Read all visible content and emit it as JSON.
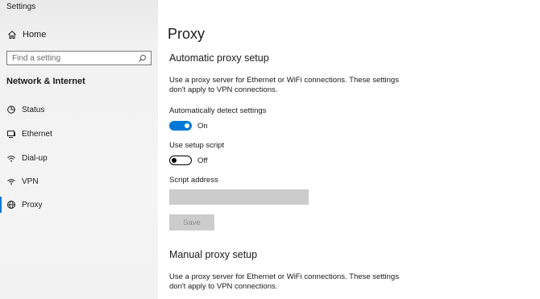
{
  "window": {
    "title": "Settings"
  },
  "sidebar": {
    "home_label": "Home",
    "search_placeholder": "Find a setting",
    "section_heading": "Network & Internet",
    "items": [
      {
        "label": "Status",
        "icon": "status-icon"
      },
      {
        "label": "Ethernet",
        "icon": "ethernet-icon"
      },
      {
        "label": "Dial-up",
        "icon": "dialup-icon"
      },
      {
        "label": "VPN",
        "icon": "vpn-icon"
      },
      {
        "label": "Proxy",
        "icon": "globe-icon",
        "active": true
      }
    ]
  },
  "main": {
    "page_title": "Proxy",
    "auto": {
      "heading": "Automatic proxy setup",
      "description": "Use a proxy server for Ethernet or WiFi connections. These settings don't apply to VPN connections.",
      "detect_label": "Automatically detect settings",
      "detect_state": "On",
      "script_label": "Use setup script",
      "script_state": "Off",
      "address_label": "Script address",
      "address_value": "",
      "save_label": "Save"
    },
    "manual": {
      "heading": "Manual proxy setup",
      "description": "Use a proxy server for Ethernet or WiFi connections. These settings don't apply to VPN connections."
    }
  },
  "colors": {
    "accent": "#0078d7",
    "disabled_fill": "#cccccc",
    "sidebar_bg": "#f2f2f2"
  }
}
